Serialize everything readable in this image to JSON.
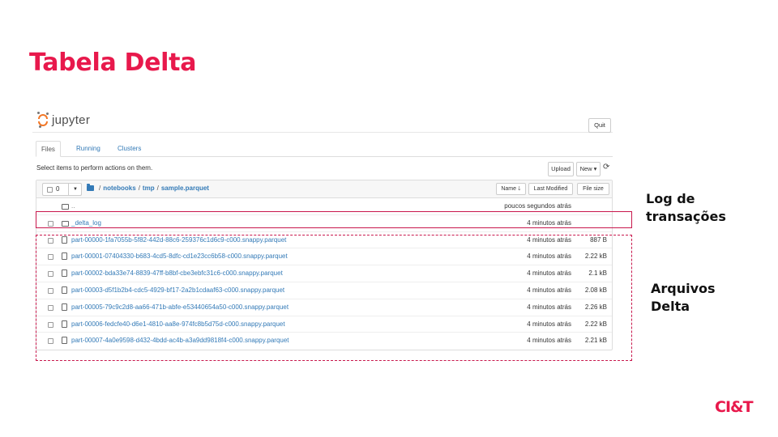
{
  "slide": {
    "title": "Tabela Delta",
    "annotations": {
      "log_label_line1": "Log de",
      "log_label_line2": "transações",
      "delta_label_line1": "Arquivos",
      "delta_label_line2": "Delta"
    },
    "brand": "CI&T",
    "colors": {
      "accent": "#e8194c",
      "jupyter_orange": "#f37726",
      "link": "#337ab7"
    }
  },
  "jupyter": {
    "logo_text": "jupyter",
    "quit_label": "Quit",
    "tabs": [
      {
        "label": "Files",
        "active": true
      },
      {
        "label": "Running",
        "active": false
      },
      {
        "label": "Clusters",
        "active": false
      }
    ],
    "select_text": "Select items to perform actions on them.",
    "upload_label": "Upload",
    "new_label": "New ▾",
    "refresh_icon": "refresh-icon",
    "selector_count": "0",
    "breadcrumb": [
      "notebooks",
      "tmp",
      "sample.parquet"
    ],
    "columns": {
      "name": "Name",
      "last_modified": "Last Modified",
      "file_size": "File size"
    },
    "parent_row": {
      "name": "..",
      "modified": "poucos segundos atrás"
    },
    "files": [
      {
        "type": "folder",
        "name": "_delta_log",
        "modified": "4 minutos atrás",
        "size": ""
      },
      {
        "type": "file",
        "name": "part-00000-1fa7055b-5f82-442d-88c6-259376c1d6c9-c000.snappy.parquet",
        "modified": "4 minutos atrás",
        "size": "887 B"
      },
      {
        "type": "file",
        "name": "part-00001-07404330-b683-4cd5-8dfc-cd1e23cc6b58-c000.snappy.parquet",
        "modified": "4 minutos atrás",
        "size": "2.22 kB"
      },
      {
        "type": "file",
        "name": "part-00002-bda33e74-8839-47ff-b8bf-cbe3ebfc31c6-c000.snappy.parquet",
        "modified": "4 minutos atrás",
        "size": "2.1 kB"
      },
      {
        "type": "file",
        "name": "part-00003-d5f1b2b4-cdc5-4929-bf17-2a2b1cdaaf63-c000.snappy.parquet",
        "modified": "4 minutos atrás",
        "size": "2.08 kB"
      },
      {
        "type": "file",
        "name": "part-00005-79c9c2d8-aa66-471b-abfe-e53440654a50-c000.snappy.parquet",
        "modified": "4 minutos atrás",
        "size": "2.26 kB"
      },
      {
        "type": "file",
        "name": "part-00006-fedcfe40-d6e1-4810-aa8e-974fc8b5d75d-c000.snappy.parquet",
        "modified": "4 minutos atrás",
        "size": "2.22 kB"
      },
      {
        "type": "file",
        "name": "part-00007-4a0e9598-d432-4bdd-ac4b-a3a9dd9818f4-c000.snappy.parquet",
        "modified": "4 minutos atrás",
        "size": "2.21 kB"
      }
    ]
  }
}
